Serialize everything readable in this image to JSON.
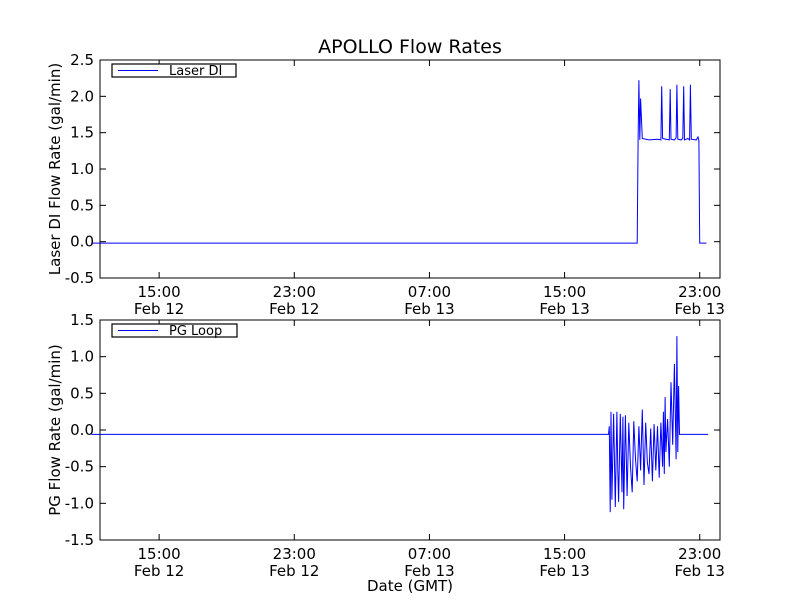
{
  "title": "APOLLO Flow Rates",
  "chart_data": [
    {
      "type": "line",
      "ylabel": "Laser DI Flow Rate (gal/min)",
      "xlabel": "",
      "ylim": [
        -0.5,
        2.5
      ],
      "yticks": [
        -0.5,
        0.0,
        0.5,
        1.0,
        1.5,
        2.0,
        2.5
      ],
      "ytick_labels": [
        "-0.5",
        "0.0",
        "0.5",
        "1.0",
        "1.5",
        "2.0",
        "2.5"
      ],
      "xlim_hours": [
        11.0,
        24.0
      ],
      "xticks": [
        {
          "hour": 15,
          "time": "15:00",
          "date": "Feb 12"
        },
        {
          "hour": 23,
          "time": "23:00",
          "date": "Feb 12"
        },
        {
          "hour": 31,
          "time": "07:00",
          "date": "Feb 13"
        },
        {
          "hour": 39,
          "time": "15:00",
          "date": "Feb 13"
        },
        {
          "hour": 47,
          "time": "23:00",
          "date": "Feb 13"
        }
      ],
      "legend": {
        "placement": "top-left",
        "entries": [
          "Laser DI"
        ]
      },
      "series": [
        {
          "name": "Laser DI",
          "color": "#0000ff",
          "x_hours": [
            11.0,
            20.0,
            30.0,
            40.0,
            43.3,
            43.35,
            43.4,
            43.45,
            43.5,
            43.6,
            44.0,
            44.5,
            44.7,
            44.75,
            44.8,
            45.0,
            45.2,
            45.25,
            45.3,
            45.5,
            45.6,
            45.65,
            45.7,
            45.9,
            46.0,
            46.05,
            46.1,
            46.3,
            46.4,
            46.45,
            46.5,
            46.8,
            46.9,
            46.95,
            47.0,
            47.4
          ],
          "y": [
            -0.02,
            -0.02,
            -0.02,
            -0.02,
            -0.02,
            1.4,
            2.22,
            1.4,
            1.97,
            1.42,
            1.4,
            1.41,
            1.4,
            2.14,
            1.42,
            1.41,
            1.4,
            2.1,
            1.41,
            1.4,
            1.43,
            2.16,
            1.41,
            1.4,
            1.42,
            2.14,
            1.4,
            1.42,
            1.4,
            2.16,
            1.41,
            1.4,
            1.44,
            1.39,
            -0.02,
            -0.02
          ]
        }
      ]
    },
    {
      "type": "line",
      "ylabel": "PG Flow Rate (gal/min)",
      "xlabel": "Date (GMT)",
      "ylim": [
        -1.5,
        1.5
      ],
      "yticks": [
        -1.5,
        -1.0,
        -0.5,
        0.0,
        0.5,
        1.0,
        1.5
      ],
      "ytick_labels": [
        "-1.5",
        "-1.0",
        "-0.5",
        "0.0",
        "0.5",
        "1.0",
        "1.5"
      ],
      "xlim_hours": [
        11.0,
        24.0
      ],
      "xticks": [
        {
          "hour": 15,
          "time": "15:00",
          "date": "Feb 12"
        },
        {
          "hour": 23,
          "time": "23:00",
          "date": "Feb 12"
        },
        {
          "hour": 31,
          "time": "07:00",
          "date": "Feb 13"
        },
        {
          "hour": 39,
          "time": "15:00",
          "date": "Feb 13"
        },
        {
          "hour": 47,
          "time": "23:00",
          "date": "Feb 13"
        }
      ],
      "legend": {
        "placement": "top-left",
        "entries": [
          "PG Loop"
        ]
      },
      "series": [
        {
          "name": "PG Loop",
          "color": "#0000ff",
          "x_hours": [
            11.0,
            20.0,
            30.0,
            40.0,
            41.6,
            41.65,
            41.7,
            41.75,
            41.8,
            41.9,
            42.0,
            42.1,
            42.15,
            42.2,
            42.3,
            42.4,
            42.45,
            42.5,
            42.6,
            42.7,
            42.8,
            42.9,
            43.0,
            43.1,
            43.2,
            43.3,
            43.4,
            43.5,
            43.6,
            43.7,
            43.8,
            43.9,
            44.0,
            44.1,
            44.2,
            44.3,
            44.4,
            44.5,
            44.6,
            44.7,
            44.8,
            44.85,
            44.9,
            44.95,
            45.0,
            45.1,
            45.2,
            45.3,
            45.4,
            45.5,
            45.6,
            45.65,
            45.7,
            45.75,
            45.8,
            46.5,
            47.5
          ],
          "y": [
            -0.06,
            -0.06,
            -0.06,
            -0.06,
            -0.06,
            0.05,
            -1.12,
            0.25,
            -0.95,
            0.22,
            -1.05,
            0.25,
            -0.55,
            -0.98,
            0.22,
            -0.85,
            0.18,
            -1.08,
            0.2,
            -0.9,
            0.1,
            -0.5,
            -0.85,
            0.12,
            -0.4,
            -0.7,
            0.05,
            -0.55,
            0.28,
            -0.75,
            0.1,
            -0.45,
            -0.6,
            0.02,
            -0.7,
            0.08,
            -0.55,
            0.05,
            -0.65,
            0.1,
            -0.5,
            0.25,
            -0.6,
            0.45,
            -0.3,
            0.15,
            -0.5,
            0.65,
            -0.2,
            0.9,
            -0.4,
            1.28,
            -0.3,
            0.6,
            -0.06,
            -0.06,
            -0.06
          ]
        }
      ]
    }
  ]
}
